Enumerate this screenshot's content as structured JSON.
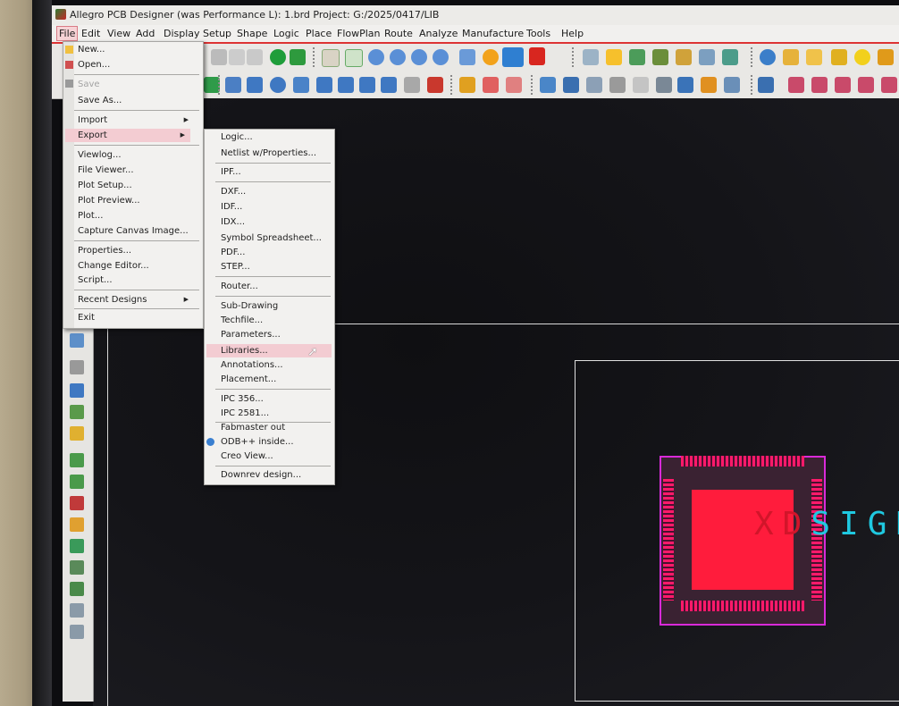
{
  "window": {
    "title": "Allegro PCB Designer (was Performance L): 1.brd  Project: G:/2025/0417/LIB"
  },
  "menubar": {
    "items": [
      "File",
      "Edit",
      "View",
      "Add",
      "Display",
      "Setup",
      "Shape",
      "Logic",
      "Place",
      "FlowPlan",
      "Route",
      "Analyze",
      "Manufacture",
      "Tools",
      "Help"
    ]
  },
  "file_menu": {
    "new": "New...",
    "open": "Open...",
    "save": "Save",
    "save_as": "Save As...",
    "import": "Import",
    "export": "Export",
    "viewlog": "Viewlog...",
    "file_viewer": "File Viewer...",
    "plot_setup": "Plot Setup...",
    "plot_preview": "Plot Preview...",
    "plot": "Plot...",
    "capture_canvas": "Capture Canvas Image...",
    "properties": "Properties...",
    "change_editor": "Change Editor...",
    "script": "Script...",
    "recent_designs": "Recent Designs",
    "exit": "Exit"
  },
  "export_menu": {
    "logic": "Logic...",
    "netlist": "Netlist w/Properties...",
    "ipf": "IPF...",
    "dxf": "DXF...",
    "idf": "IDF...",
    "idx": "IDX...",
    "symbol_spreadsheet": "Symbol Spreadsheet...",
    "pdf": "PDF...",
    "step": "STEP...",
    "router": "Router...",
    "sub_drawing": "Sub-Drawing",
    "techfile": "Techfile...",
    "parameters": "Parameters...",
    "libraries": "Libraries...",
    "annotations": "Annotations...",
    "placement": "Placement...",
    "ipc356": "IPC 356...",
    "ipc2581": "IPC 2581...",
    "fabmaster": "Fabmaster out",
    "odb": "ODB++ inside...",
    "creo": "Creo View...",
    "downrev": "Downrev design..."
  },
  "canvas": {
    "silkscreen_ghost": "XD",
    "silkscreen_text": "SIGNA"
  },
  "colors": {
    "menu_highlight": "#f3ccd2",
    "pads": "#ff1a6a",
    "die": "#ff1c3c",
    "outline": "#d92ad9",
    "silkscreen": "#1fc8e0"
  }
}
